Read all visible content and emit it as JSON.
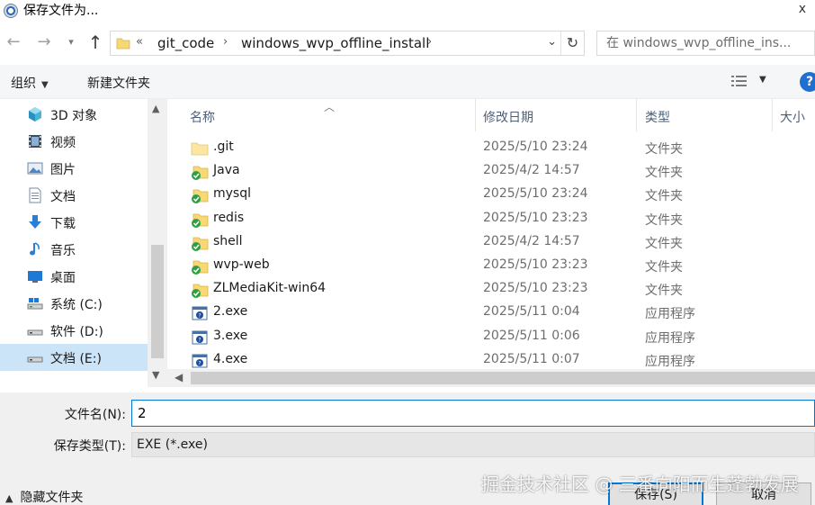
{
  "window": {
    "title": "保存文件为...",
    "close_glyph": "x"
  },
  "address": {
    "crumbs": [
      "«",
      "git_code",
      "›",
      "windows_wvp_offline_install",
      "›"
    ],
    "search_placeholder": "在 windows_wvp_offline_ins..."
  },
  "toolbar": {
    "organize_label": "组织",
    "new_folder_label": "新建文件夹",
    "help_glyph": "?"
  },
  "nav": {
    "items": [
      {
        "label": "3D 对象",
        "icon": "cube-icon"
      },
      {
        "label": "视频",
        "icon": "video-icon"
      },
      {
        "label": "图片",
        "icon": "pictures-icon"
      },
      {
        "label": "文档",
        "icon": "documents-icon"
      },
      {
        "label": "下载",
        "icon": "download-icon"
      },
      {
        "label": "音乐",
        "icon": "music-icon"
      },
      {
        "label": "桌面",
        "icon": "desktop-icon"
      },
      {
        "label": "系统 (C:)",
        "icon": "drive-icon"
      },
      {
        "label": "软件 (D:)",
        "icon": "drive-icon"
      },
      {
        "label": "文档 (E:)",
        "icon": "drive-icon",
        "selected": true
      }
    ]
  },
  "columns": {
    "name": "名称",
    "date": "修改日期",
    "type": "类型",
    "size": "大小"
  },
  "files": [
    {
      "name": ".git",
      "date": "2025/5/10 23:24",
      "type": "文件夹",
      "icon": "folder-icon"
    },
    {
      "name": "Java",
      "date": "2025/4/2 14:57",
      "type": "文件夹",
      "icon": "folder-synced-icon"
    },
    {
      "name": "mysql",
      "date": "2025/5/10 23:24",
      "type": "文件夹",
      "icon": "folder-synced-icon"
    },
    {
      "name": "redis",
      "date": "2025/5/10 23:23",
      "type": "文件夹",
      "icon": "folder-synced-icon"
    },
    {
      "name": "shell",
      "date": "2025/4/2 14:57",
      "type": "文件夹",
      "icon": "folder-synced-icon"
    },
    {
      "name": "wvp-web",
      "date": "2025/5/10 23:23",
      "type": "文件夹",
      "icon": "folder-synced-icon"
    },
    {
      "name": "ZLMediaKit-win64",
      "date": "2025/5/10 23:23",
      "type": "文件夹",
      "icon": "folder-synced-icon"
    },
    {
      "name": "2.exe",
      "date": "2025/5/11 0:04",
      "type": "应用程序",
      "icon": "exe-icon"
    },
    {
      "name": "3.exe",
      "date": "2025/5/11 0:06",
      "type": "应用程序",
      "icon": "exe-icon"
    },
    {
      "name": "4.exe",
      "date": "2025/5/11 0:07",
      "type": "应用程序",
      "icon": "exe-icon"
    }
  ],
  "form": {
    "filename_label": "文件名(N):",
    "filename_value": "2",
    "filetype_label": "保存类型(T):",
    "filetype_value": "EXE (*.exe)"
  },
  "footer": {
    "hide_folders_label": "隐藏文件夹",
    "save_label": "保存(S)",
    "cancel_label": "取消",
    "watermark": "掘金技术社区 @ 三番向阳而生蓬勃发展"
  }
}
